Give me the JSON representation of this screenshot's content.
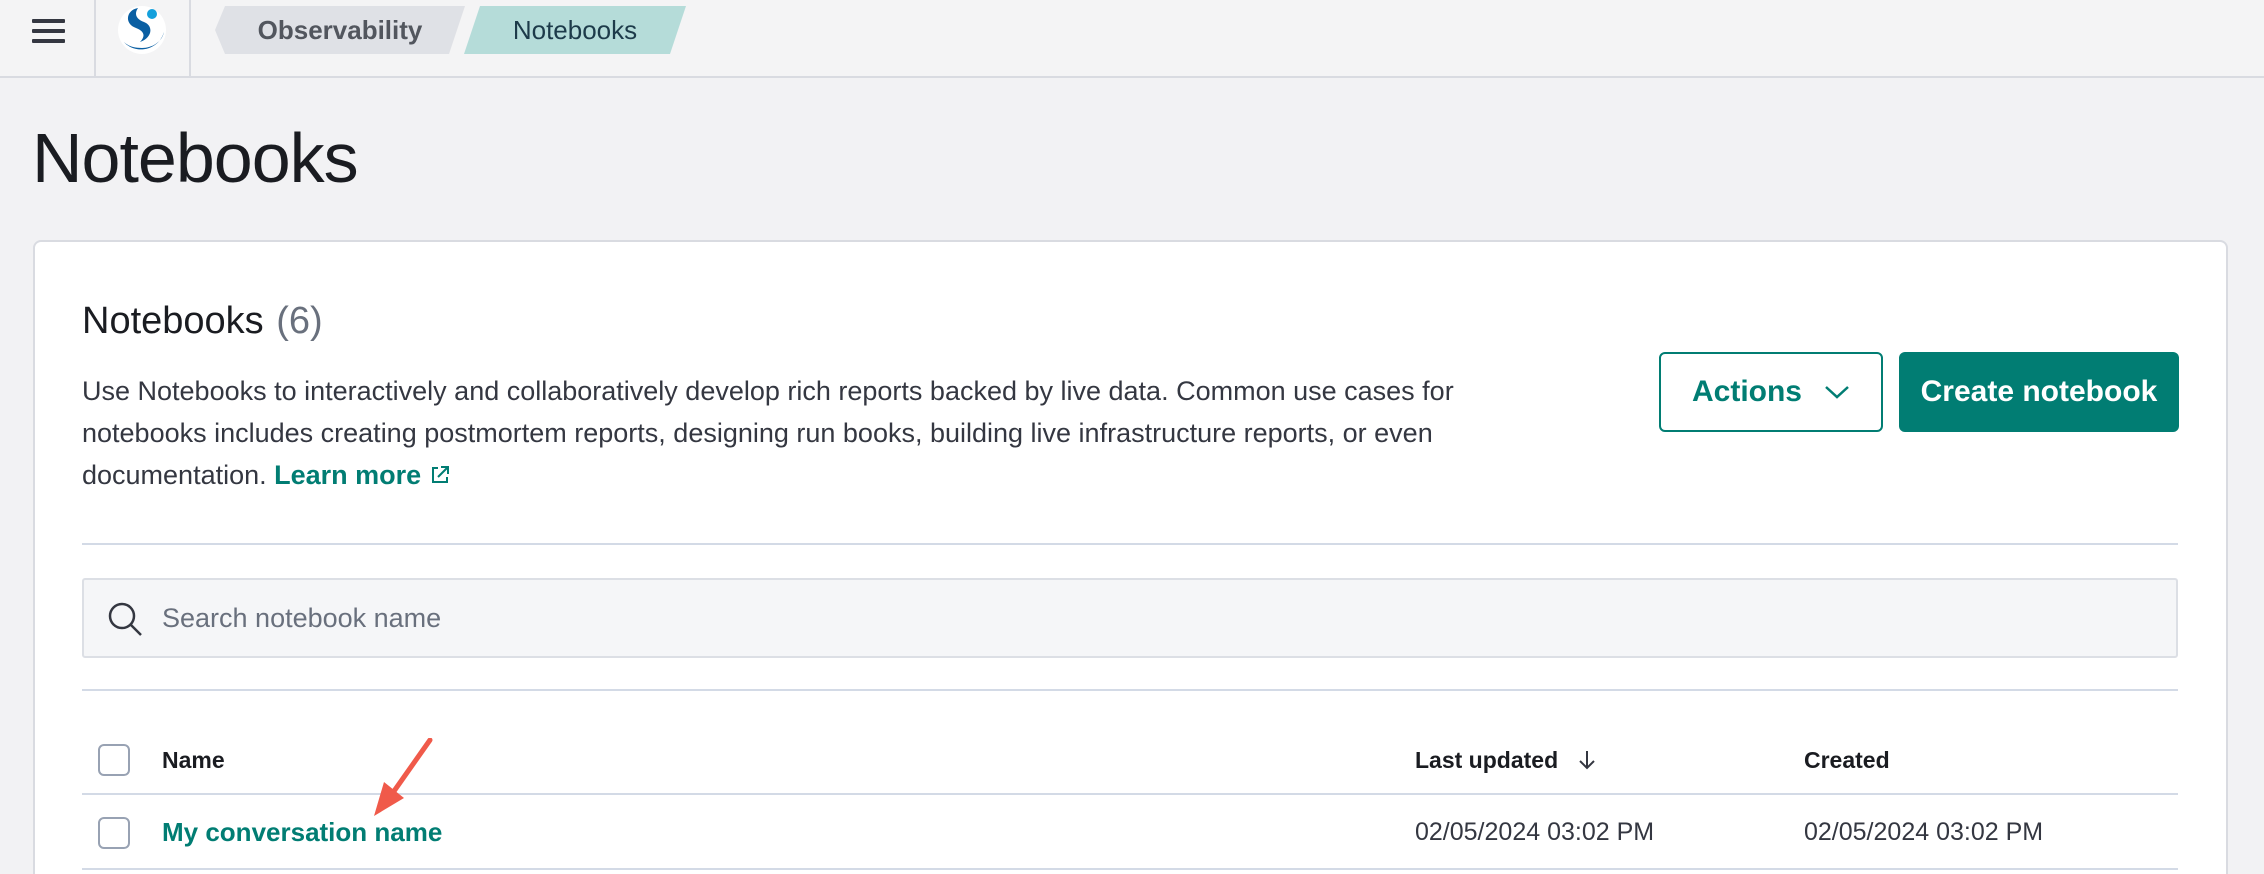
{
  "breadcrumbs": [
    {
      "label": "Observability"
    },
    {
      "label": "Notebooks"
    }
  ],
  "page": {
    "title": "Notebooks"
  },
  "panel": {
    "title": "Notebooks",
    "count": "(6)",
    "description": "Use Notebooks to interactively and collaboratively develop rich reports backed by live data. Common use cases for notebooks includes creating postmortem reports, designing run books, building live infrastructure reports, or even documentation.",
    "learn_more": "Learn more"
  },
  "actions": {
    "actions_label": "Actions",
    "create_label": "Create notebook"
  },
  "search": {
    "placeholder": "Search notebook name",
    "value": ""
  },
  "table": {
    "columns": {
      "name": "Name",
      "last_updated": "Last updated",
      "created": "Created"
    },
    "rows": [
      {
        "name": "My conversation name",
        "last_updated": "02/05/2024 03:02 PM",
        "created": "02/05/2024 03:02 PM"
      }
    ]
  },
  "colors": {
    "accent": "#017d73",
    "breadcrumb_active": "#b5dcd9",
    "annotation": "#f05a4a"
  },
  "icons": [
    "menu-icon",
    "logo-icon",
    "chevron-down-icon",
    "external-link-icon",
    "search-icon",
    "sort-arrow-down-icon",
    "annotation-arrow-icon"
  ]
}
